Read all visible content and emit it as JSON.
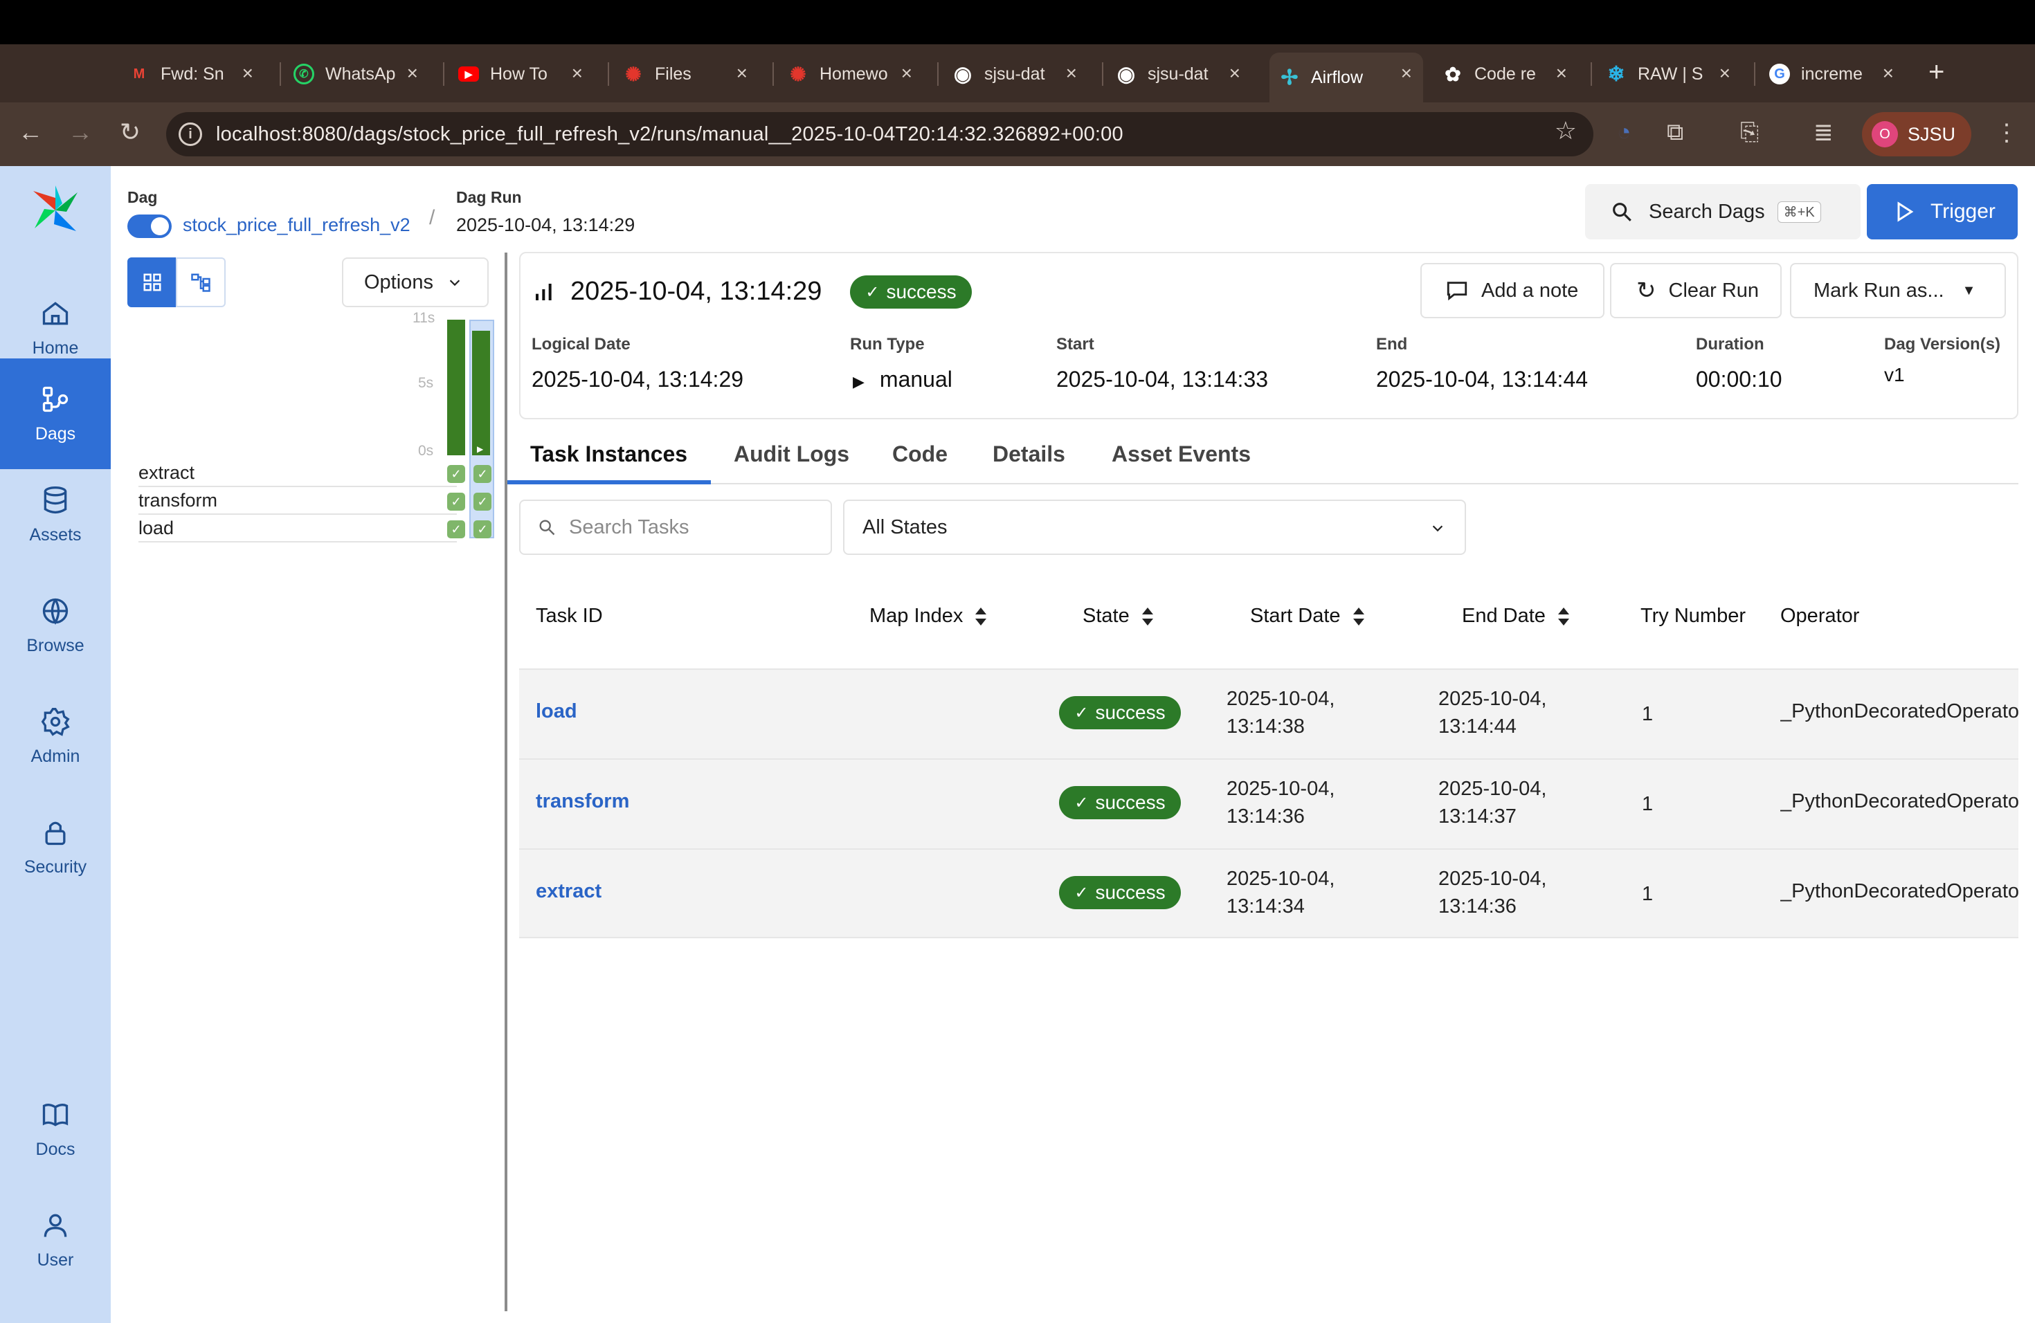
{
  "browser": {
    "tabs": [
      {
        "label": "Fwd: Sn",
        "icon": "gmail-icon",
        "color": "#ea4335",
        "glyph": "M"
      },
      {
        "label": "WhatsAp",
        "icon": "whatsapp-icon",
        "color": "#25d366",
        "glyph": "✆"
      },
      {
        "label": "How To",
        "icon": "youtube-icon",
        "color": "#ff0000",
        "glyph": "▶"
      },
      {
        "label": "Files",
        "icon": "canvas-icon",
        "color": "#e3362c",
        "glyph": "✺"
      },
      {
        "label": "Homewo",
        "icon": "canvas-icon",
        "color": "#e3362c",
        "glyph": "✺"
      },
      {
        "label": "sjsu-dat",
        "icon": "github-icon",
        "color": "#ffffff",
        "glyph": "◉"
      },
      {
        "label": "sjsu-dat",
        "icon": "github-icon",
        "color": "#ffffff",
        "glyph": "◉"
      },
      {
        "label": "Airflow",
        "icon": "airflow-icon",
        "color": "#39c1d6",
        "glyph": "✢"
      },
      {
        "label": "Code re",
        "icon": "openai-icon",
        "color": "#ffffff",
        "glyph": "✿"
      },
      {
        "label": "RAW | S",
        "icon": "snowflake-icon",
        "color": "#29b5e8",
        "glyph": "❄"
      },
      {
        "label": "increme",
        "icon": "google-icon",
        "color": "#4285f4",
        "glyph": "G"
      }
    ],
    "url": "localhost:8080/dags/stock_price_full_refresh_v2/runs/manual__2025-10-04T20:14:32.326892+00:00",
    "profile_initial": "O",
    "profile_name": "SJSU"
  },
  "sidebar": {
    "items": [
      {
        "label": "Home"
      },
      {
        "label": "Dags"
      },
      {
        "label": "Assets"
      },
      {
        "label": "Browse"
      },
      {
        "label": "Admin"
      },
      {
        "label": "Security"
      },
      {
        "label": "Docs"
      },
      {
        "label": "User"
      }
    ]
  },
  "breadcrumb": {
    "dag_label": "Dag",
    "dag_value": "stock_price_full_refresh_v2",
    "run_label": "Dag Run",
    "run_value": "2025-10-04, 13:14:29"
  },
  "header": {
    "search_label": "Search Dags",
    "search_shortcut": "⌘+K",
    "trigger_label": "Trigger"
  },
  "grid": {
    "options_label": "Options",
    "axis": [
      "11s",
      "5s",
      "0s"
    ],
    "tasks": [
      "extract",
      "transform",
      "load"
    ]
  },
  "run": {
    "title": "2025-10-04, 13:14:29",
    "state": "success",
    "add_note": "Add a note",
    "clear_run": "Clear Run",
    "mark_as": "Mark Run as...",
    "meta": {
      "logical_label": "Logical Date",
      "logical_value": "2025-10-04, 13:14:29",
      "type_label": "Run Type",
      "type_value": "manual",
      "start_label": "Start",
      "start_value": "2025-10-04, 13:14:33",
      "end_label": "End",
      "end_value": "2025-10-04, 13:14:44",
      "duration_label": "Duration",
      "duration_value": "00:00:10",
      "version_label": "Dag Version(s)",
      "version_value": "v1"
    }
  },
  "tabs": [
    "Task Instances",
    "Audit Logs",
    "Code",
    "Details",
    "Asset Events"
  ],
  "filters": {
    "search_placeholder": "Search Tasks",
    "states_value": "All States"
  },
  "table": {
    "headers": {
      "task_id": "Task ID",
      "map_index": "Map Index",
      "state": "State",
      "start": "Start Date",
      "end": "End Date",
      "try": "Try Number",
      "operator": "Operator"
    },
    "rows": [
      {
        "task_id": "load",
        "state": "success",
        "start_d": "2025-10-04,",
        "start_t": "13:14:38",
        "end_d": "2025-10-04,",
        "end_t": "13:14:44",
        "try": "1",
        "operator": "_PythonDecoratedOperator"
      },
      {
        "task_id": "transform",
        "state": "success",
        "start_d": "2025-10-04,",
        "start_t": "13:14:36",
        "end_d": "2025-10-04,",
        "end_t": "13:14:37",
        "try": "1",
        "operator": "_PythonDecoratedOperator"
      },
      {
        "task_id": "extract",
        "state": "success",
        "start_d": "2025-10-04,",
        "start_t": "13:14:34",
        "end_d": "2025-10-04,",
        "end_t": "13:14:36",
        "try": "1",
        "operator": "_PythonDecoratedOperator"
      }
    ]
  },
  "colors": {
    "accent": "#2f6fd6",
    "success": "#2c7a28",
    "sidebar": "#c9dcf6"
  }
}
